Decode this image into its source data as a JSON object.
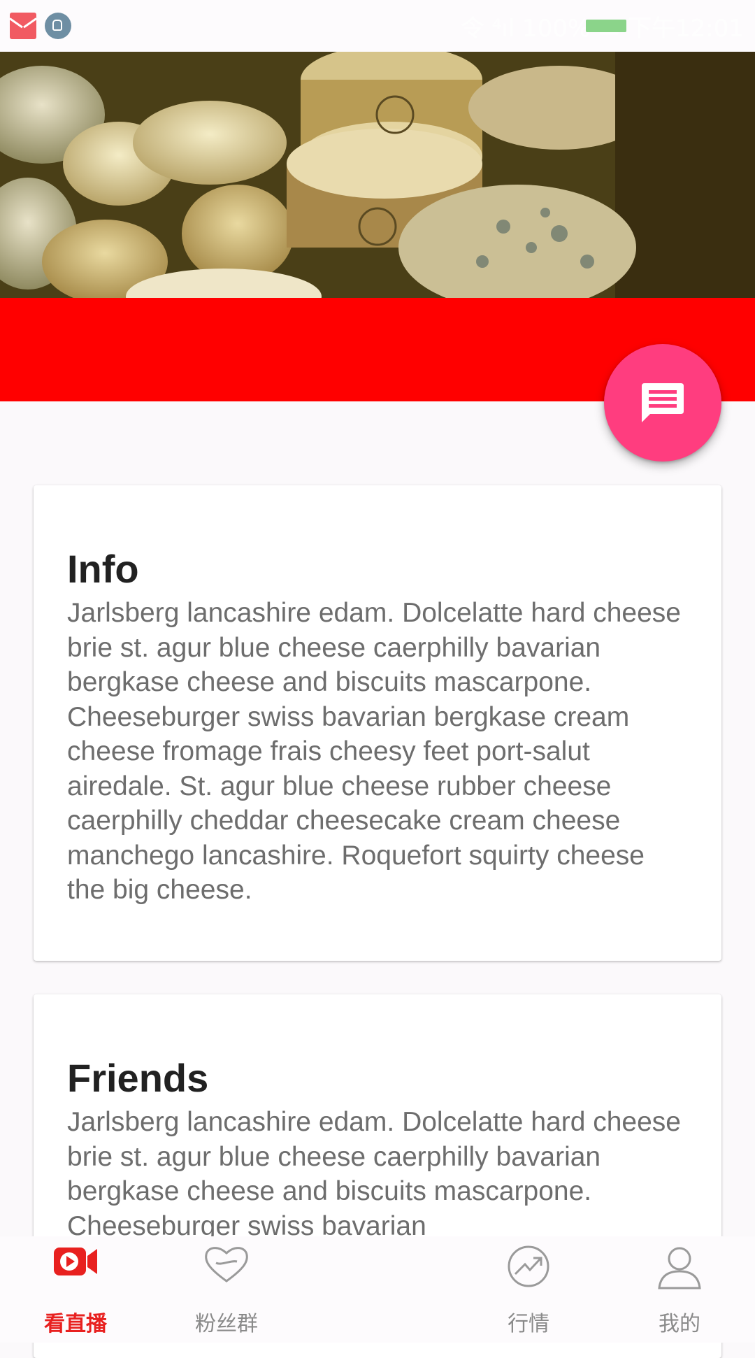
{
  "status_bar": {
    "left_icons": [
      "mail-icon",
      "android-icon"
    ],
    "right_text": "令 ⁴ıl 100%  ▬  下午12:01"
  },
  "hero": {
    "image": "cheese-wheels-photo"
  },
  "fab": {
    "icon": "message-icon",
    "color": "#ff3d7f"
  },
  "colors": {
    "red_band": "#ff0000",
    "active_nav": "#e8201f"
  },
  "cards": [
    {
      "title": "Info",
      "body": "Jarlsberg lancashire edam. Dolcelatte hard cheese brie st. agur blue cheese caerphilly bavarian bergkase cheese and biscuits mascarpone. Cheeseburger swiss bavarian bergkase cream cheese fromage frais cheesy feet port-salut airedale. St. agur blue cheese rubber cheese caerphilly cheddar cheesecake cream cheese manchego lancashire. Roquefort squirty cheese the big cheese."
    },
    {
      "title": "Friends",
      "body": "Jarlsberg lancashire edam. Dolcelatte hard cheese brie st. agur blue cheese caerphilly bavarian bergkase cheese and biscuits mascarpone. Cheeseburger swiss bavarian"
    }
  ],
  "bottom_nav": {
    "items": [
      {
        "label": "看直播",
        "icon": "live-video-icon",
        "active": true
      },
      {
        "label": "粉丝群",
        "icon": "heart-icon",
        "active": false
      },
      {
        "label": "行情",
        "icon": "trend-icon",
        "active": false
      },
      {
        "label": "我的",
        "icon": "person-icon",
        "active": false
      }
    ]
  }
}
